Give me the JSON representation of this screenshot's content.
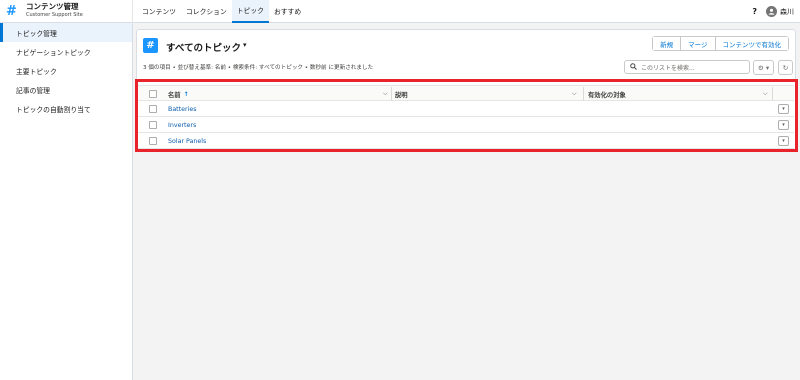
{
  "app": {
    "icon": "#",
    "title": "コンテンツ管理",
    "subtitle": "Customer Support Site"
  },
  "nav": {
    "tabs": [
      "コンテンツ",
      "コレクション",
      "トピック",
      "おすすめ"
    ],
    "active": "トピック"
  },
  "header_right": {
    "help": "?",
    "avatar_icon": "user-icon",
    "user": "森川"
  },
  "sidebar": {
    "items": [
      "トピック管理",
      "ナビゲーショントピック",
      "主要トピック",
      "記事の管理",
      "トピックの自動割り当て"
    ],
    "active": "トピック管理"
  },
  "list": {
    "icon": "#",
    "title": "すべてのトピック",
    "caret": "▾",
    "status": "3 個の項目 • 並び替え基準: 名前 • 検索条件: すべてのトピック • 数秒前 に更新されました",
    "buttons": [
      "新規",
      "マージ",
      "コンテンツで有効化"
    ],
    "search_placeholder": "このリストを検索...",
    "gear_label": "⚙ ▾",
    "refresh_label": "↻"
  },
  "table": {
    "columns": [
      "名前",
      "説明",
      "有効化の対象"
    ],
    "sort_indicator": "↑",
    "rows": [
      {
        "name": "Batteries",
        "description": "",
        "enabled_for": ""
      },
      {
        "name": "Inverters",
        "description": "",
        "enabled_for": ""
      },
      {
        "name": "Solar Panels",
        "description": "",
        "enabled_for": ""
      }
    ],
    "row_menu": "▾"
  },
  "colors": {
    "accent": "#0176d3",
    "brand_icon": "#1b96ff",
    "highlight": "#e8232c"
  }
}
